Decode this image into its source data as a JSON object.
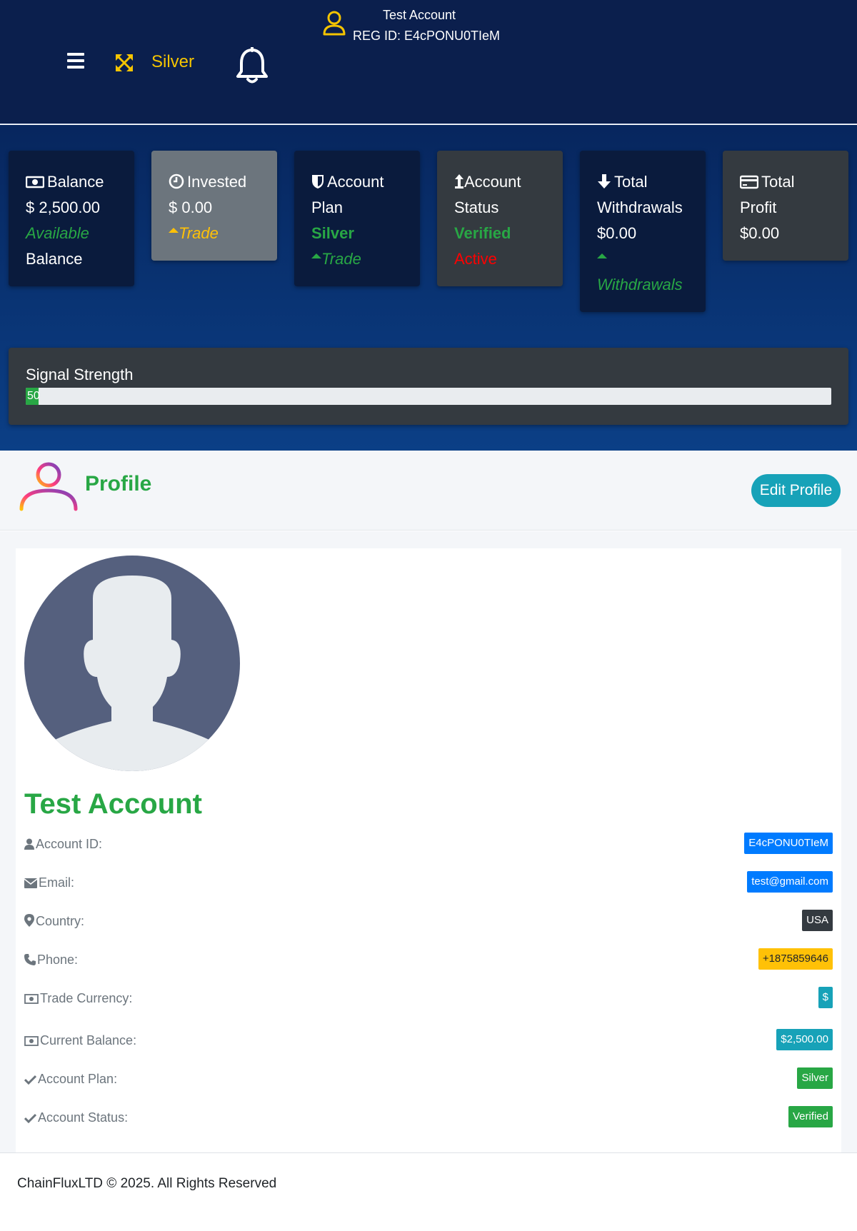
{
  "header": {
    "plan_label": "Silver",
    "user_name": "Test Account",
    "reg_id": "REG ID: E4cPONU0TIeM",
    "icons": {
      "menu": "hamburger-icon",
      "plan": "expand-arrows-icon",
      "notifications": "bell-icon",
      "user": "user-outline-icon"
    }
  },
  "cards": {
    "balance": {
      "title": "Balance",
      "amount": "$ 2,500.00",
      "sub1": "Available",
      "sub2": "Balance"
    },
    "invested": {
      "title": "Invested",
      "amount": "$ 0.00",
      "sub": "Trade"
    },
    "plan": {
      "title_line1": "Account",
      "title_line2": "Plan",
      "value": "Silver",
      "sub": "Trade"
    },
    "status": {
      "title_line1": "Account",
      "title_line2": "Status",
      "value1": "Verified",
      "value2": "Active"
    },
    "withdrawals": {
      "title_line1": "Total",
      "title_line2": "Withdrawals",
      "amount": "$0.00",
      "sub": "Withdrawals"
    },
    "profit": {
      "title_line1": "Total",
      "title_line2": "Profit",
      "amount": "$0.00"
    }
  },
  "signal": {
    "title": "Signal Strength",
    "value_label": "50",
    "value_fraction": 0.016
  },
  "profile": {
    "title": "Profile",
    "edit_label": "Edit Profile",
    "name": "Test Account",
    "rows": [
      {
        "label": "Account ID:",
        "value": "E4cPONU0TIeM",
        "icon": "user-icon"
      },
      {
        "label": "Email:",
        "value": "test@gmail.com",
        "icon": "envelope-icon"
      },
      {
        "label": "Country:",
        "value": "USA",
        "icon": "map-pin-icon"
      },
      {
        "label": "Phone:",
        "value": "+1875859646",
        "icon": "phone-icon"
      },
      {
        "label": "Trade Currency:",
        "value": "$",
        "icon": "money-bill-icon"
      },
      {
        "label": "Current Balance:",
        "value": "$2,500.00",
        "icon": "money-bill-icon"
      },
      {
        "label": "Account Plan:",
        "value": "Silver",
        "icon": "check-icon"
      },
      {
        "label": "Account Status:",
        "value": "Verified",
        "icon": "check-icon"
      }
    ]
  },
  "footer": {
    "text": "ChainFluxLTD © 2025. All Rights Reserved"
  },
  "colors": {
    "header_bg": "#0b1f4d",
    "accent_green": "#28a745",
    "accent_yellow": "#f5c400",
    "teal": "#17a2b8",
    "blue": "#007bff"
  }
}
